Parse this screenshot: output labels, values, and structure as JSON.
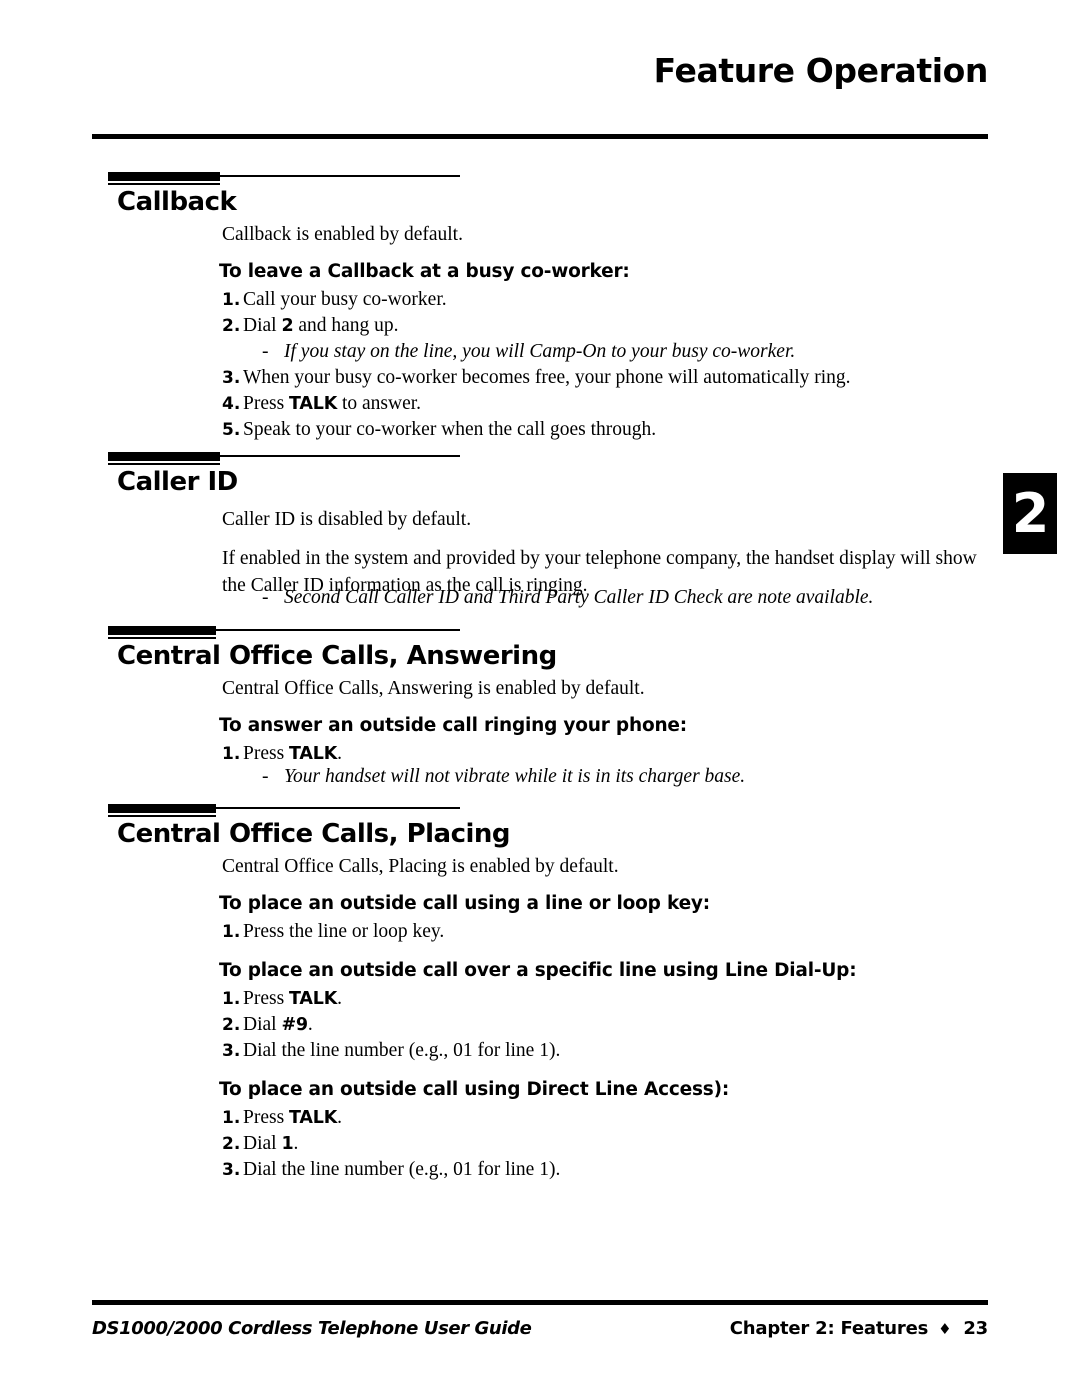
{
  "header": {
    "title": "Feature Operation",
    "chapter_tab": "2"
  },
  "sections": [
    {
      "heading": "Callback",
      "intro": "Callback is enabled by default.",
      "procedures": [
        {
          "title": "To leave a Callback at a busy co-worker:",
          "steps": [
            {
              "num": "1.",
              "pre": "Call your busy co-worker.",
              "kbd": "",
              "post": ""
            },
            {
              "num": "2.",
              "pre": "Dial ",
              "kbd": "2",
              "post": " and hang up."
            },
            {
              "num": "3.",
              "pre": "When your busy co-worker becomes free, your phone will automatically ring.",
              "kbd": "",
              "post": ""
            },
            {
              "num": "4.",
              "pre": "Press ",
              "kbd": "TALK",
              "post": " to answer."
            },
            {
              "num": "5.",
              "pre": "Speak to your co-worker when the call goes through.",
              "kbd": "",
              "post": ""
            }
          ],
          "note_after_step2": "If you stay on the line, you will Camp-On to your busy co-worker."
        }
      ]
    },
    {
      "heading": "Caller ID",
      "intro": "Caller ID is disabled by default.",
      "paragraph": "If enabled in the system and provided by your telephone company, the handset display will show the Caller ID information as the call is ringing.",
      "note": "Second Call Caller ID and Third Party Caller ID Check are note available."
    },
    {
      "heading": "Central Office Calls, Answering",
      "intro": "Central Office Calls, Answering is enabled by default.",
      "procedures": [
        {
          "title": "To answer an outside call ringing your phone:",
          "steps": [
            {
              "num": "1.",
              "pre": "Press ",
              "kbd": "TALK",
              "post": "."
            }
          ],
          "note": "Your handset will not vibrate while it is in its charger base."
        }
      ]
    },
    {
      "heading": "Central Office Calls, Placing",
      "intro": "Central Office Calls, Placing is enabled by default.",
      "procedures": [
        {
          "title": "To place an outside call using a line or loop key:",
          "steps": [
            {
              "num": "1.",
              "pre": "Press the line or loop key.",
              "kbd": "",
              "post": ""
            }
          ]
        },
        {
          "title": "To place an outside call over a specific line using Line Dial-Up:",
          "steps": [
            {
              "num": "1.",
              "pre": "Press ",
              "kbd": "TALK",
              "post": "."
            },
            {
              "num": "2.",
              "pre": "Dial ",
              "kbd": "#9",
              "post": "."
            },
            {
              "num": "3.",
              "pre": "Dial the line number (e.g., 01 for line 1).",
              "kbd": "",
              "post": ""
            }
          ]
        },
        {
          "title": "To place an outside call using Direct Line Access):",
          "steps": [
            {
              "num": "1.",
              "pre": "Press ",
              "kbd": "TALK",
              "post": "."
            },
            {
              "num": "2.",
              "pre": "Dial ",
              "kbd": "1",
              "post": "."
            },
            {
              "num": "3.",
              "pre": "Dial the line number (e.g., 01 for line 1).",
              "kbd": "",
              "post": ""
            }
          ]
        }
      ]
    }
  ],
  "footer": {
    "left": "DS1000/2000 Cordless Telephone User Guide",
    "chapter": "Chapter 2: Features",
    "diamond": "♦",
    "page": "23"
  }
}
